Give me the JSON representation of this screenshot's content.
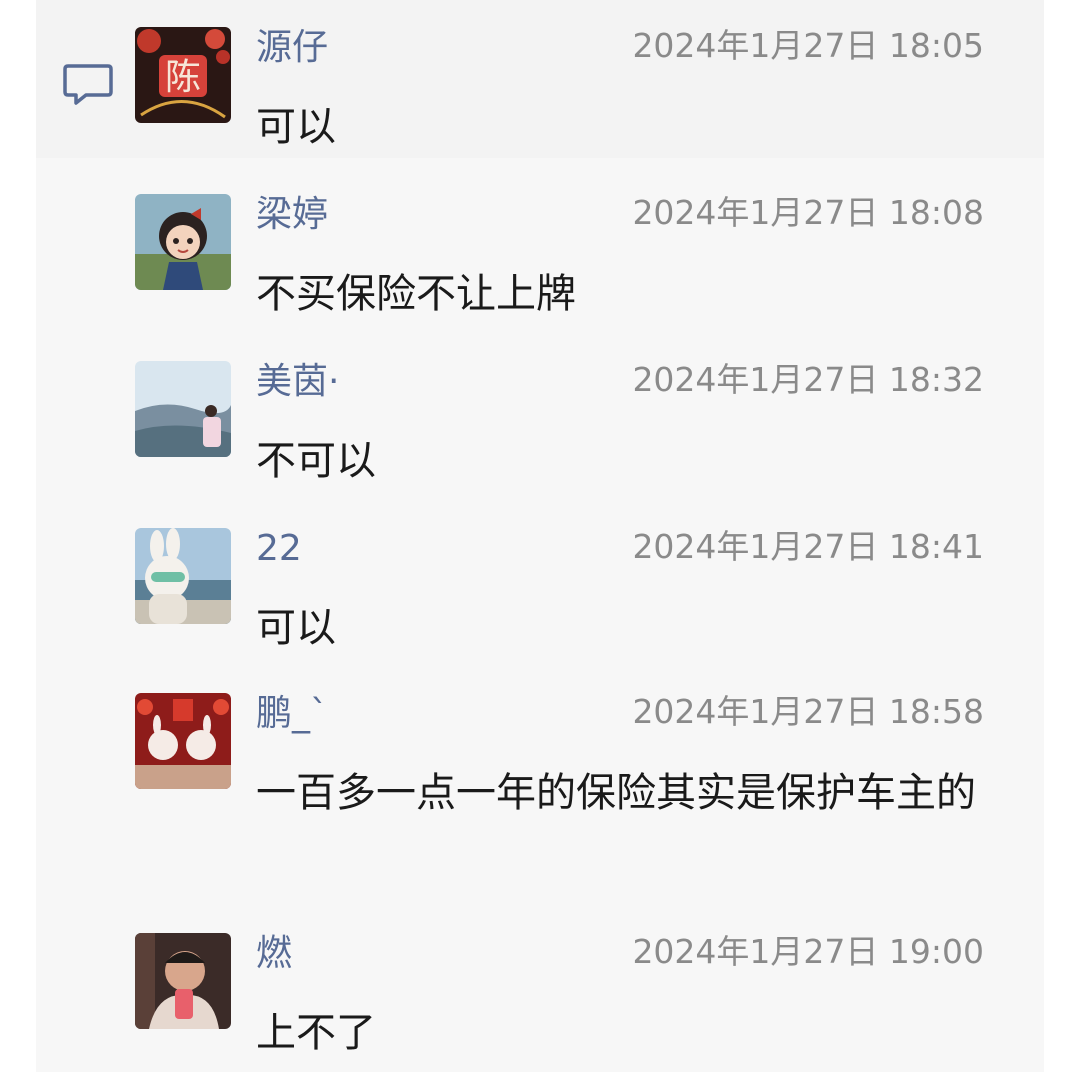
{
  "comments": [
    {
      "name": "源仔",
      "time": "2024年1月27日 18:05",
      "text": "可以",
      "avatar": "red-chen-character-avatar"
    },
    {
      "name": "梁婷",
      "time": "2024年1月27日 18:08",
      "text": "不买保险不让上牌",
      "avatar": "cartoon-girl-avatar"
    },
    {
      "name": "美茵·",
      "time": "2024年1月27日 18:32",
      "text": "不可以",
      "avatar": "landscape-girl-avatar"
    },
    {
      "name": "22",
      "time": "2024年1月27日 18:41",
      "text": "可以",
      "avatar": "bunny-beach-avatar"
    },
    {
      "name": "鹏_`",
      "time": "2024年1月27日 18:58",
      "text": "一百多一点一年的保险其实是保护车主的",
      "avatar": "festive-bunnies-avatar"
    },
    {
      "name": "燃",
      "time": "2024年1月27日 19:00",
      "text": "上不了",
      "avatar": "man-selfie-avatar"
    }
  ],
  "icons": {
    "comment": "comment-icon"
  },
  "colors": {
    "name": "#576b95",
    "time": "#8a8a8a",
    "text": "#1a1a1a",
    "panel": "#f7f7f7"
  }
}
